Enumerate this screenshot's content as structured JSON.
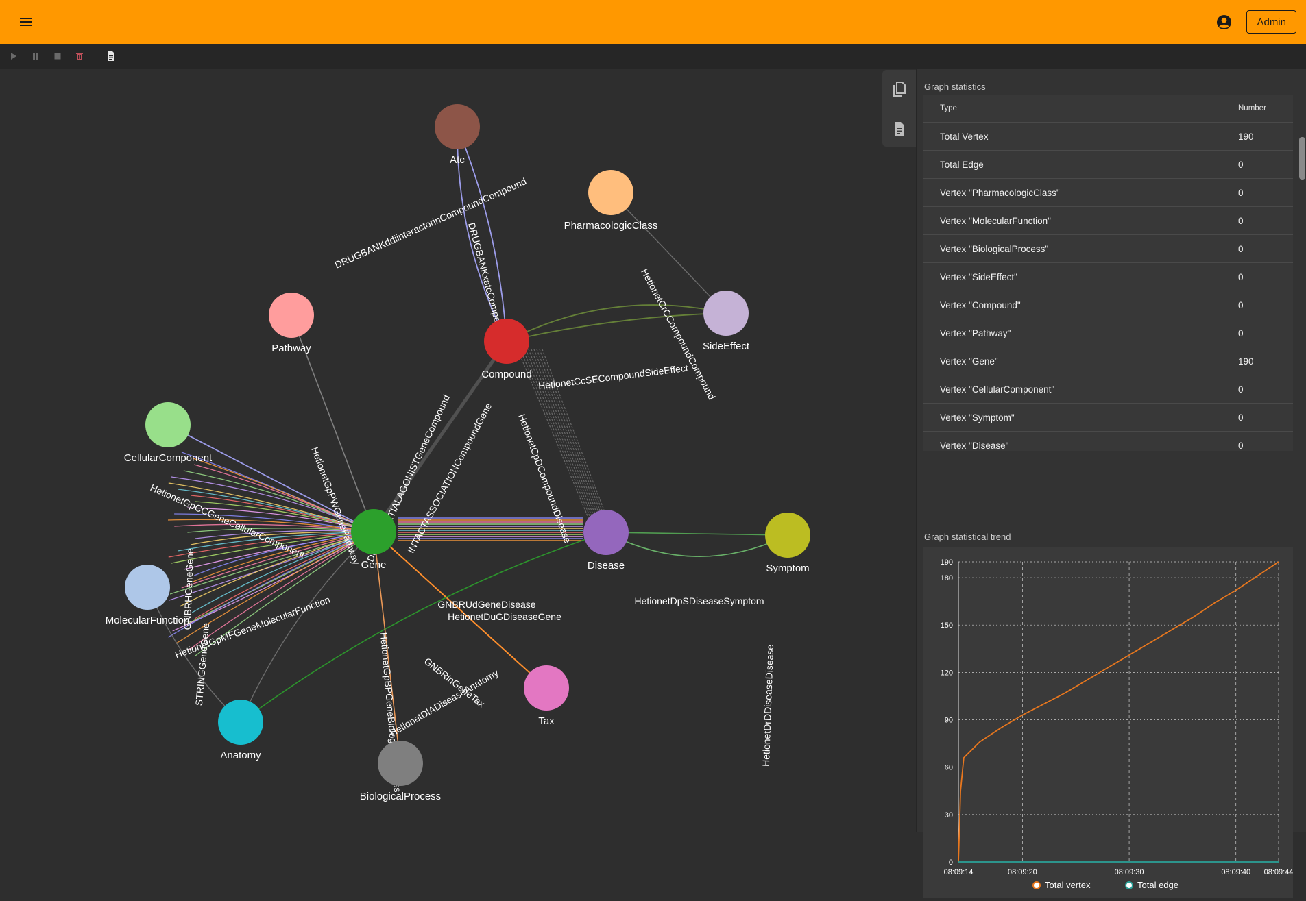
{
  "header": {
    "admin_label": "Admin"
  },
  "icons": {
    "menu": "menu-icon",
    "account": "account-circle-icon",
    "play": "play-icon",
    "pause": "pause-icon",
    "stop": "stop-icon",
    "delete": "delete-icon",
    "document": "document-icon"
  },
  "colors": {
    "brand": "#ff9800"
  },
  "graph": {
    "nodes": [
      {
        "label": "Atc",
        "color": "#8d5548"
      },
      {
        "label": "PharmacologicClass",
        "color": "#ffbe7d"
      },
      {
        "label": "Pathway",
        "color": "#ff9d9d"
      },
      {
        "label": "Compound",
        "color": "#d62c2c"
      },
      {
        "label": "SideEffect",
        "color": "#c5b2d6"
      },
      {
        "label": "CellularComponent",
        "color": "#98df8a"
      },
      {
        "label": "Gene",
        "color": "#2ca02c"
      },
      {
        "label": "Disease",
        "color": "#9467bd"
      },
      {
        "label": "Symptom",
        "color": "#bcbd22"
      },
      {
        "label": "MolecularFunction",
        "color": "#aec7e8"
      },
      {
        "label": "Tax",
        "color": "#e377c2"
      },
      {
        "label": "Anatomy",
        "color": "#17becf"
      },
      {
        "label": "BiologicalProcess",
        "color": "#7f7f7f"
      }
    ],
    "edge_labels": [
      "DRUGBANKddiinteractorinCompoundCompound",
      "DRUGBANKxatcCompoundAtc",
      "HetionetCrCCompoundCompound",
      "HetionetCcSECompoundSideEffect",
      "HetionetGpPWGenePathway",
      "HetionetGpCCGeneCellularComponent",
      "HetionetCpDCompoundDisease",
      "GNBRUdGeneDisease",
      "HetionetDuGDiseaseGene",
      "HetionetDpSDiseaseSymptom",
      "HetionetDrDDiseaseDisease",
      "GNBRinGeneTax",
      "HetionetDlADiseaseAnatomy",
      "INTACTASSOCIATIONCompoundGene",
      "DGIDBPARTIALAGONISTGeneCompound",
      "STRINGGeneGene",
      "GNBRHGeneGene",
      "HetionetGpBPGeneBiologicalProcess",
      "HetionetGpMFGeneMolecularFunction"
    ]
  },
  "stats": {
    "title": "Graph statistics",
    "col_type": "Type",
    "col_number": "Number",
    "rows": [
      {
        "type": "Total Vertex",
        "number": "190"
      },
      {
        "type": "Total Edge",
        "number": "0"
      },
      {
        "type": "Vertex \"PharmacologicClass\"",
        "number": "0"
      },
      {
        "type": "Vertex \"MolecularFunction\"",
        "number": "0"
      },
      {
        "type": "Vertex \"BiologicalProcess\"",
        "number": "0"
      },
      {
        "type": "Vertex \"SideEffect\"",
        "number": "0"
      },
      {
        "type": "Vertex \"Compound\"",
        "number": "0"
      },
      {
        "type": "Vertex \"Pathway\"",
        "number": "0"
      },
      {
        "type": "Vertex \"Gene\"",
        "number": "190"
      },
      {
        "type": "Vertex \"CellularComponent\"",
        "number": "0"
      },
      {
        "type": "Vertex \"Symptom\"",
        "number": "0"
      },
      {
        "type": "Vertex \"Disease\"",
        "number": "0"
      }
    ]
  },
  "trend": {
    "title": "Graph statistical trend",
    "chart_data": {
      "type": "line",
      "x_ticks": [
        "08:09:14",
        "08:09:20",
        "08:09:30",
        "08:09:40",
        "08:09:44"
      ],
      "y_ticks": [
        0,
        30,
        60,
        90,
        120,
        150,
        180,
        190
      ],
      "ylim": [
        0,
        190
      ],
      "xlim_seconds": [
        0,
        30
      ],
      "series": [
        {
          "name": "Total vertex",
          "color": "#e8771e",
          "points": [
            [
              0,
              0
            ],
            [
              0.2,
              45
            ],
            [
              0.5,
              66
            ],
            [
              2,
              76
            ],
            [
              4,
              85
            ],
            [
              6,
              93
            ],
            [
              8,
              100
            ],
            [
              10,
              107
            ],
            [
              12,
              115
            ],
            [
              14,
              123
            ],
            [
              16,
              131
            ],
            [
              18,
              139
            ],
            [
              20,
              147
            ],
            [
              22,
              155
            ],
            [
              24,
              164
            ],
            [
              26,
              172
            ],
            [
              28,
              181
            ],
            [
              30,
              190
            ]
          ]
        },
        {
          "name": "Total edge",
          "color": "#2aa198",
          "points": [
            [
              0,
              0
            ],
            [
              30,
              0
            ]
          ]
        }
      ]
    }
  }
}
